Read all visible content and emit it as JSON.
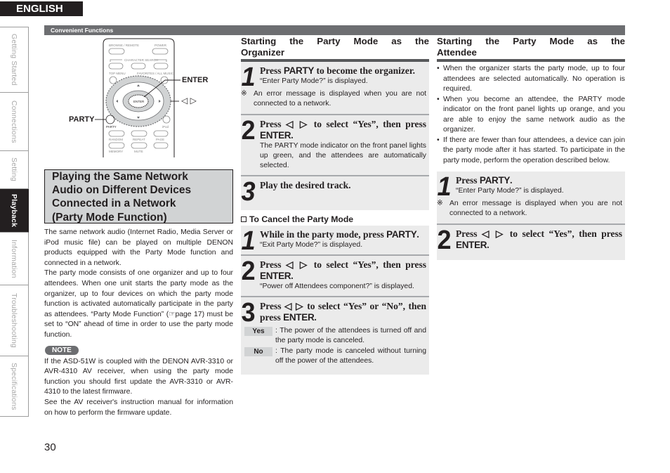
{
  "language_tab": "ENGLISH",
  "side_nav": [
    {
      "label": "Getting Started",
      "active": false
    },
    {
      "label": "Connections",
      "active": false
    },
    {
      "label": "Setting",
      "active": false
    },
    {
      "label": "Playback",
      "active": true
    },
    {
      "label": "Information",
      "active": false
    },
    {
      "label": "Troubleshooting",
      "active": false
    },
    {
      "label": "Specifications",
      "active": false
    }
  ],
  "section_bar": "Convenient Functions",
  "remote": {
    "buttons": [
      "BROWSE / REMOTE",
      "POWER",
      "CHARACTER SEARCH",
      "TOP MENU",
      "FAVORITES / ALL MUSIC",
      "ENTER",
      "PARTY",
      "iPod",
      "RANDOM",
      "REPEAT",
      "PAGE",
      "MEMORY",
      "MUTE"
    ],
    "callouts": {
      "enter": "ENTER",
      "cursor": "◁ ▷",
      "party": "PARTY"
    }
  },
  "left": {
    "title_lines": [
      "Playing the Same Network",
      "Audio on Different Devices",
      "Connected in a Network",
      "(Party Mode Function)"
    ],
    "para1": "The same network audio (Internet Radio, Media Server or iPod music file) can be played on multiple DENON products equipped with the Party Mode function and connected in a network.",
    "para2": "The party mode consists of one organizer and up to four attendees. When one unit starts the party mode as the organizer, up to four devices on which the party mode function is activated automatically participate in the party as attendees. “Party Mode Function” (☞page 17) must be set to “ON” ahead of time in order to use the party mode function.",
    "note_label": "NOTE",
    "note1": "If the ASD-51W is coupled with the DENON AVR-3310 or AVR-4310 AV receiver, when using the party mode function you should first update the AVR-3310 or AVR-4310 to the latest firmware.",
    "note2": "See the AV receiver's instruction manual for information on how to perform the firmware update."
  },
  "organizer": {
    "heading_words": [
      "Starting",
      "the",
      "Party",
      "Mode",
      "as",
      "the"
    ],
    "heading_line2": "Organizer",
    "steps": [
      {
        "num": "1",
        "title_pre": "Press ",
        "title_key": "PARTY",
        "title_post": " to become the organizer.",
        "desc": "“Enter Party Mode?” is displayed.",
        "note_mark": "※",
        "note": "An error message is displayed when you are not connected to a network."
      },
      {
        "num": "2",
        "title_pre": "Press ◁  ▷ to select “Yes”, then press ",
        "title_key": "ENTER",
        "title_post": ".",
        "desc": "The PARTY mode indicator on the front panel lights up green, and the attendees are automatically selected."
      },
      {
        "num": "3",
        "title_pre": "Play the desired track.",
        "title_key": "",
        "title_post": ""
      }
    ]
  },
  "cancel": {
    "heading": "To Cancel the Party Mode",
    "steps": [
      {
        "num": "1",
        "title_pre": "While in the party mode, press ",
        "title_key": "PARTY",
        "title_post": ".",
        "desc": "“Exit Party Mode?” is displayed."
      },
      {
        "num": "2",
        "title_pre": "Press ◁  ▷ to select “Yes”, then press ",
        "title_key": "ENTER",
        "title_post": ".",
        "desc": "“Power off Attendees component?” is displayed."
      },
      {
        "num": "3",
        "title_pre": "Press ◁  ▷ to select “Yes” or “No”, then press ",
        "title_key": "ENTER",
        "title_post": "."
      }
    ],
    "options": [
      {
        "key": "Yes",
        "value": ": The power of the attendees is turned off and the party mode is canceled."
      },
      {
        "key": "No",
        "value": ": The party mode is canceled without turning off the power of the attendees."
      }
    ]
  },
  "attendee": {
    "heading_words": [
      "Starting",
      "the",
      "Party",
      "Mode",
      "as",
      "the"
    ],
    "heading_line2": "Attendee",
    "bullets": [
      "When the organizer starts the party mode, up to four attendees are selected automatically. No operation is required.",
      "When you become an attendee, the PARTY mode indicator on the front panel lights up orange, and you are able to enjoy the same network audio as the organizer.",
      "If there are fewer than four attendees, a device can join the party mode after it has started. To participate in the party mode, perform the operation described below."
    ],
    "steps": [
      {
        "num": "1",
        "title_pre": "Press ",
        "title_key": "PARTY",
        "title_post": ".",
        "desc": "“Enter Party Mode?” is displayed.",
        "note_mark": "※",
        "note": "An error message is displayed when you are not connected to a network."
      },
      {
        "num": "2",
        "title_pre": "Press ◁  ▷ to select “Yes”, then press ",
        "title_key": "ENTER",
        "title_post": "."
      }
    ]
  },
  "page_number": "30"
}
